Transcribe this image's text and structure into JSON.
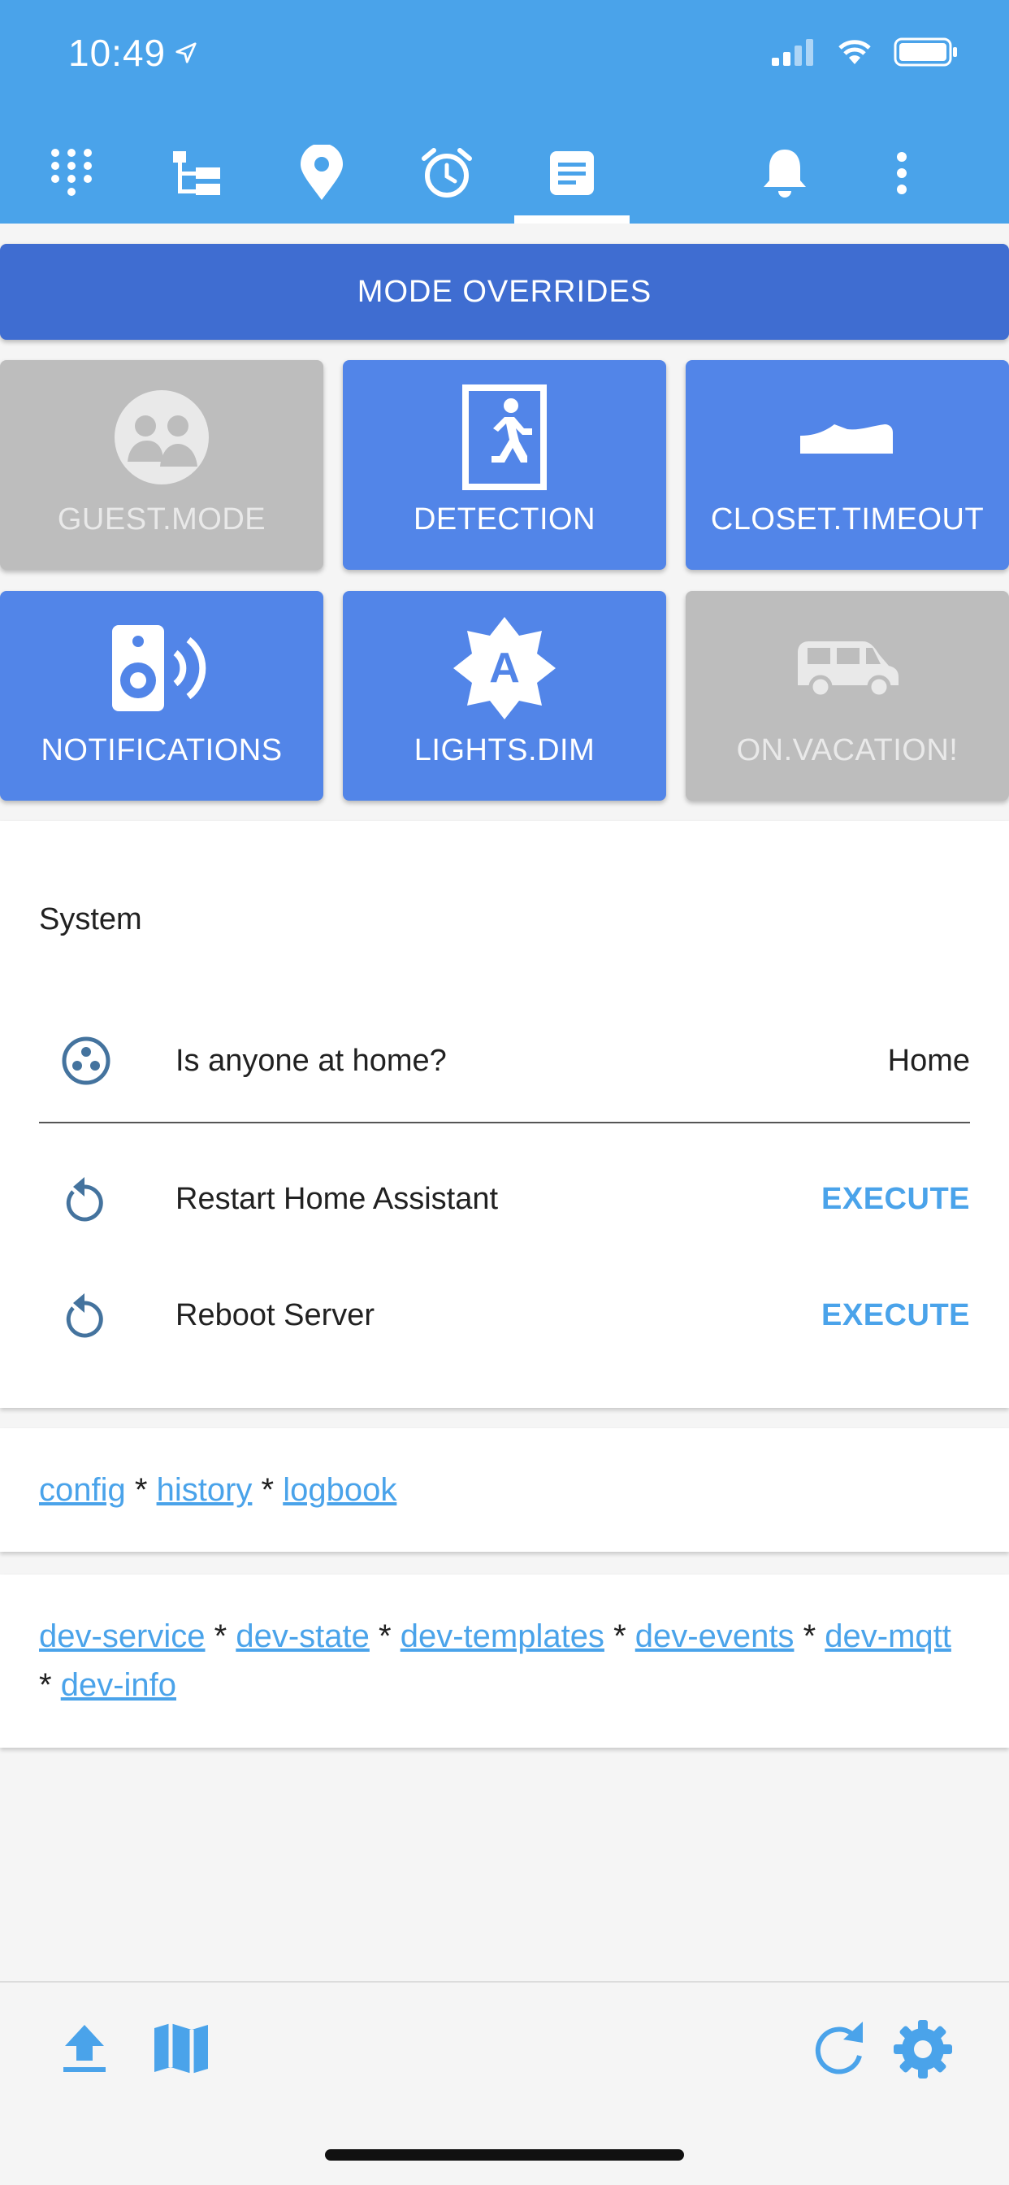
{
  "status_bar": {
    "time": "10:49"
  },
  "colors": {
    "header": "#4aa3ea",
    "tile_on": "#5285e8",
    "tile_off": "#bdbdbd",
    "link": "#4aa3ea",
    "mode_header": "#3f6dd1"
  },
  "tabs": [
    {
      "icon": "dialpad-icon"
    },
    {
      "icon": "hierarchy-icon"
    },
    {
      "icon": "map-pin-icon"
    },
    {
      "icon": "alarm-clock-icon"
    },
    {
      "icon": "document-icon",
      "active": true
    },
    {
      "icon": "bell-icon"
    },
    {
      "icon": "more-vertical-icon"
    }
  ],
  "mode_overrides": {
    "title": "MODE OVERRIDES",
    "tiles": [
      {
        "label": "GUEST.MODE",
        "icon": "guests-icon",
        "on": false
      },
      {
        "label": "DETECTION",
        "icon": "exit-run-icon",
        "on": true
      },
      {
        "label": "CLOSET.TIMEOUT",
        "icon": "shoe-icon",
        "on": true
      },
      {
        "label": "NOTIFICATIONS",
        "icon": "speaker-icon",
        "on": true
      },
      {
        "label": "LIGHTS.DIM",
        "icon": "auto-brightness-icon",
        "on": true
      },
      {
        "label": "ON.VACATION!",
        "icon": "van-icon",
        "on": false
      }
    ]
  },
  "system": {
    "title": "System",
    "rows": [
      {
        "label": "Is anyone at home?",
        "value": "Home",
        "icon": "group-icon"
      },
      {
        "label": "Restart Home Assistant",
        "action": "EXECUTE",
        "icon": "restart-icon"
      },
      {
        "label": "Reboot Server",
        "action": "EXECUTE",
        "icon": "restart-icon"
      }
    ]
  },
  "links_card_1": {
    "items": [
      "config",
      "history",
      "logbook"
    ],
    "separator": "*"
  },
  "links_card_2": {
    "items": [
      "dev-service",
      "dev-state",
      "dev-templates",
      "dev-events",
      "dev-mqtt",
      "dev-info"
    ],
    "separator": "*"
  },
  "footer": {
    "left_icons": [
      "upload-icon",
      "map-icon"
    ],
    "right_icons": [
      "refresh-icon",
      "settings-icon"
    ]
  }
}
